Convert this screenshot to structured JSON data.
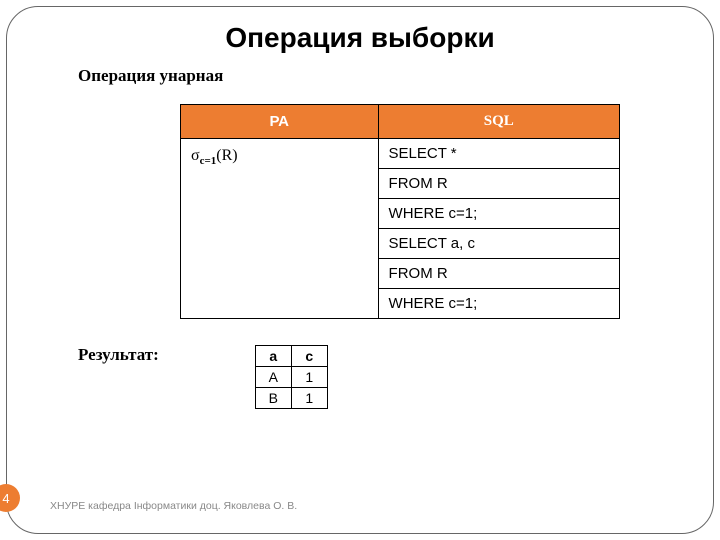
{
  "title": "Операция выборки",
  "subtitle": "Операция унарная",
  "headers": {
    "ra": "РА",
    "sql": "SQL"
  },
  "ra_expr": {
    "sigma": "σ",
    "sub": "c=1",
    "arg": "(R)"
  },
  "sql_block1": {
    "l1": "SELECT *",
    "l2": "FROM R",
    "l3": "WHERE c=1;"
  },
  "sql_block2": {
    "l1": "SELECT a, c",
    "l2": "FROM R",
    "l3": "WHERE c=1;"
  },
  "result_label": "Результат:",
  "result_table": {
    "head": {
      "a": "a",
      "c": "c"
    },
    "rows": [
      {
        "a": "A",
        "c": "1"
      },
      {
        "a": "B",
        "c": "1"
      }
    ]
  },
  "slide_number": "4",
  "footer": "ХНУРЕ кафедра Інформатики доц. Яковлева О. В."
}
